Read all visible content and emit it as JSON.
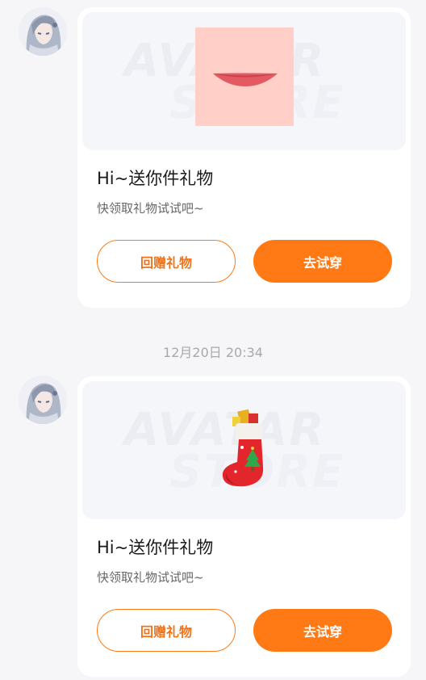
{
  "messages": [
    {
      "title": "Hi~送你件礼物",
      "subtitle": "快领取礼物试试吧~",
      "return_gift_label": "回赠礼物",
      "try_on_label": "去试穿",
      "gift_icon": "lips-icon"
    },
    {
      "title": "Hi~送你件礼物",
      "subtitle": "快领取礼物试试吧~",
      "return_gift_label": "回赠礼物",
      "try_on_label": "去试穿",
      "gift_icon": "christmas-stocking-icon"
    }
  ],
  "timestamp": "12月20日 20:34",
  "colors": {
    "accent": "#ff7a14",
    "background": "#f6f6f8"
  }
}
